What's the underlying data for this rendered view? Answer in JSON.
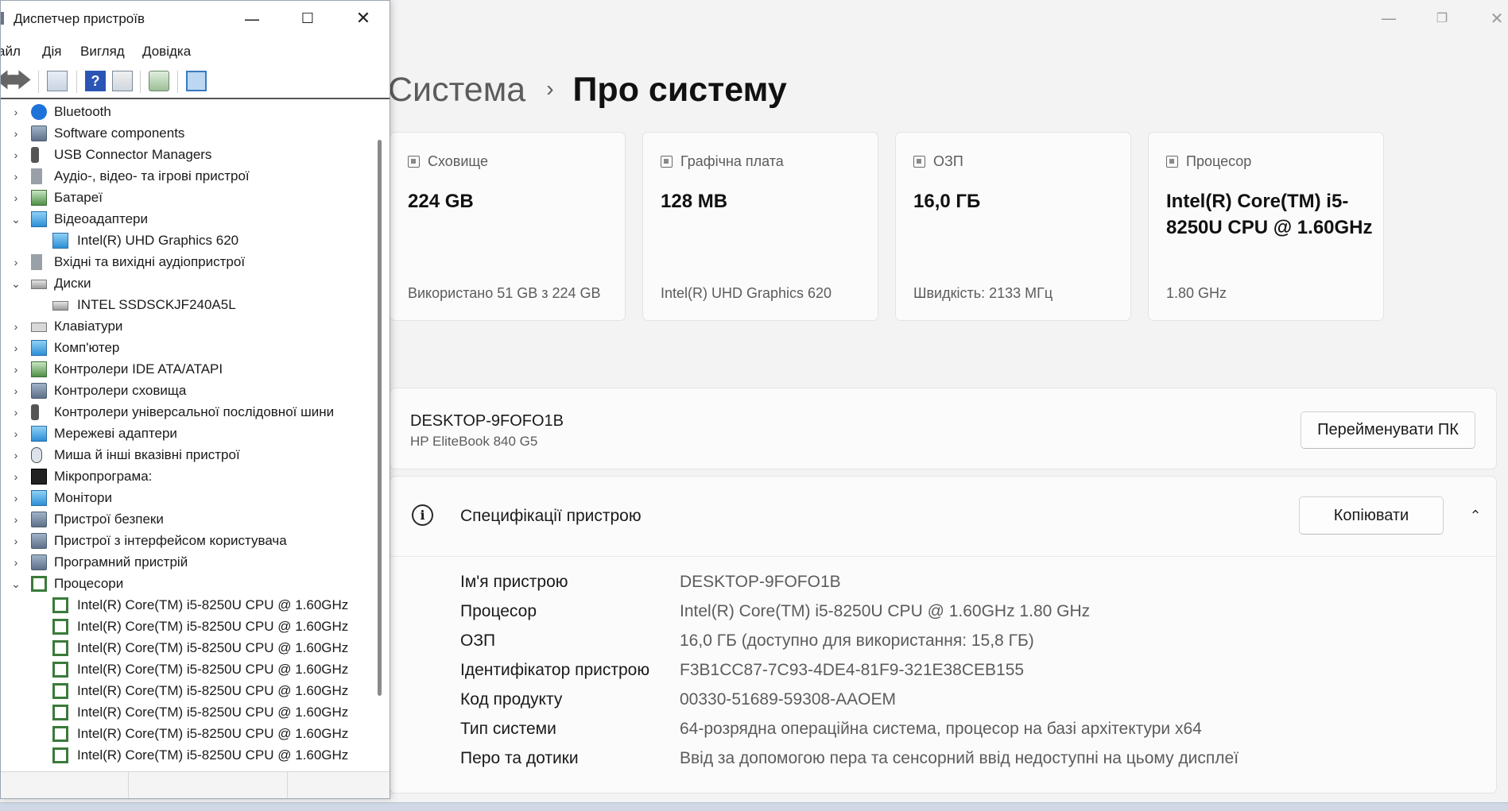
{
  "settings": {
    "window_controls": {
      "minimize": "—",
      "maximize": "❐",
      "close": "✕"
    },
    "breadcrumb": {
      "parent": "Система",
      "separator": "›",
      "current": "Про систему"
    },
    "cards": [
      {
        "title": "Сховище",
        "value": "224 GB",
        "sub": "Використано 51 GB з 224 GB",
        "icon": "storage-icon"
      },
      {
        "title": "Графічна плата",
        "value": "128 MB",
        "sub": "Intel(R) UHD Graphics 620",
        "icon": "gpu-icon"
      },
      {
        "title": "ОЗП",
        "value": "16,0 ГБ",
        "sub": "Швидкість: 2133 МГц",
        "icon": "ram-icon"
      },
      {
        "title": "Процесор",
        "value": "Intel(R) Core(TM) i5-8250U CPU @ 1.60GHz",
        "sub": "1.80 GHz",
        "icon": "cpu-icon"
      }
    ],
    "device": {
      "name": "DESKTOP-9FOFO1B",
      "model": "HP EliteBook 840 G5",
      "rename_label": "Перейменувати ПК"
    },
    "specs": {
      "title": "Специфікації пристрою",
      "info_glyph": "i",
      "copy_label": "Копіювати",
      "collapse_glyph": "⌃",
      "rows": [
        {
          "label": "Ім'я пристрою",
          "value": "DESKTOP-9FOFO1B"
        },
        {
          "label": "Процесор",
          "value": "Intel(R) Core(TM) i5-8250U CPU @ 1.60GHz   1.80 GHz"
        },
        {
          "label": "ОЗП",
          "value": "16,0 ГБ (доступно для використання: 15,8 ГБ)"
        },
        {
          "label": "Ідентифікатор пристрою",
          "value": "F3B1CC87-7C93-4DE4-81F9-321E38CEB155"
        },
        {
          "label": "Код продукту",
          "value": "00330-51689-59308-AAOEM"
        },
        {
          "label": "Тип системи",
          "value": "64-розрядна операційна система, процесор на базі архітектури x64"
        },
        {
          "label": "Перо та дотики",
          "value": "Ввід за допомогою пера та сенсорний ввід недоступні на цьому дисплеї"
        }
      ]
    }
  },
  "device_manager": {
    "title": "Диспетчер пристроїв",
    "window_controls": {
      "minimize": "—",
      "maximize": "☐",
      "close": "✕"
    },
    "menu": {
      "file": "айл",
      "action": "Дія",
      "view": "Вигляд",
      "help": "Довідка"
    },
    "toolbar": {
      "back": "🡄",
      "forward": "🡆",
      "help": "?"
    },
    "tree": [
      {
        "label": "Bluetooth",
        "expander": "›",
        "level": 0,
        "icon": "bluetooth-icon"
      },
      {
        "label": "Software components",
        "expander": "›",
        "level": 0,
        "icon": "software-component-icon"
      },
      {
        "label": "USB Connector Managers",
        "expander": "›",
        "level": 0,
        "icon": "usb-icon"
      },
      {
        "label": "Аудіо-, відео- та ігрові пристрої",
        "expander": "›",
        "level": 0,
        "icon": "speaker-icon"
      },
      {
        "label": "Батареї",
        "expander": "›",
        "level": 0,
        "icon": "battery-icon"
      },
      {
        "label": "Відеоадаптери",
        "expander": "⌄",
        "level": 0,
        "icon": "display-adapter-icon"
      },
      {
        "label": "Intel(R) UHD Graphics 620",
        "expander": "",
        "level": 1,
        "icon": "display-adapter-icon"
      },
      {
        "label": "Вхідні та вихідні аудіопристрої",
        "expander": "›",
        "level": 0,
        "icon": "speaker-icon"
      },
      {
        "label": "Диски",
        "expander": "⌄",
        "level": 0,
        "icon": "disk-icon"
      },
      {
        "label": "INTEL SSDSCKJF240A5L",
        "expander": "",
        "level": 1,
        "icon": "disk-icon"
      },
      {
        "label": "Клавіатури",
        "expander": "›",
        "level": 0,
        "icon": "keyboard-icon"
      },
      {
        "label": "Комп'ютер",
        "expander": "›",
        "level": 0,
        "icon": "computer-icon"
      },
      {
        "label": "Контролери IDE ATA/ATAPI",
        "expander": "›",
        "level": 0,
        "icon": "ide-controller-icon"
      },
      {
        "label": "Контролери сховища",
        "expander": "›",
        "level": 0,
        "icon": "storage-controller-icon"
      },
      {
        "label": "Контролери універсальної послідовної шини",
        "expander": "›",
        "level": 0,
        "icon": "usb-icon"
      },
      {
        "label": "Мережеві адаптери",
        "expander": "›",
        "level": 0,
        "icon": "network-adapter-icon"
      },
      {
        "label": "Миша й інші вказівні пристрої",
        "expander": "›",
        "level": 0,
        "icon": "mouse-icon"
      },
      {
        "label": "Мікропрограма:",
        "expander": "›",
        "level": 0,
        "icon": "firmware-icon"
      },
      {
        "label": "Монітори",
        "expander": "›",
        "level": 0,
        "icon": "monitor-icon"
      },
      {
        "label": "Пристрої безпеки",
        "expander": "›",
        "level": 0,
        "icon": "security-device-icon"
      },
      {
        "label": "Пристрої з інтерфейсом користувача",
        "expander": "›",
        "level": 0,
        "icon": "hid-icon"
      },
      {
        "label": "Програмний пристрій",
        "expander": "›",
        "level": 0,
        "icon": "software-device-icon"
      },
      {
        "label": "Процесори",
        "expander": "⌄",
        "level": 0,
        "icon": "processor-icon"
      },
      {
        "label": "Intel(R) Core(TM) i5-8250U CPU @ 1.60GHz",
        "expander": "",
        "level": 1,
        "icon": "processor-icon"
      },
      {
        "label": "Intel(R) Core(TM) i5-8250U CPU @ 1.60GHz",
        "expander": "",
        "level": 1,
        "icon": "processor-icon"
      },
      {
        "label": "Intel(R) Core(TM) i5-8250U CPU @ 1.60GHz",
        "expander": "",
        "level": 1,
        "icon": "processor-icon"
      },
      {
        "label": "Intel(R) Core(TM) i5-8250U CPU @ 1.60GHz",
        "expander": "",
        "level": 1,
        "icon": "processor-icon"
      },
      {
        "label": "Intel(R) Core(TM) i5-8250U CPU @ 1.60GHz",
        "expander": "",
        "level": 1,
        "icon": "processor-icon"
      },
      {
        "label": "Intel(R) Core(TM) i5-8250U CPU @ 1.60GHz",
        "expander": "",
        "level": 1,
        "icon": "processor-icon"
      },
      {
        "label": "Intel(R) Core(TM) i5-8250U CPU @ 1.60GHz",
        "expander": "",
        "level": 1,
        "icon": "processor-icon"
      },
      {
        "label": "Intel(R) Core(TM) i5-8250U CPU @ 1.60GHz",
        "expander": "",
        "level": 1,
        "icon": "processor-icon"
      }
    ]
  }
}
